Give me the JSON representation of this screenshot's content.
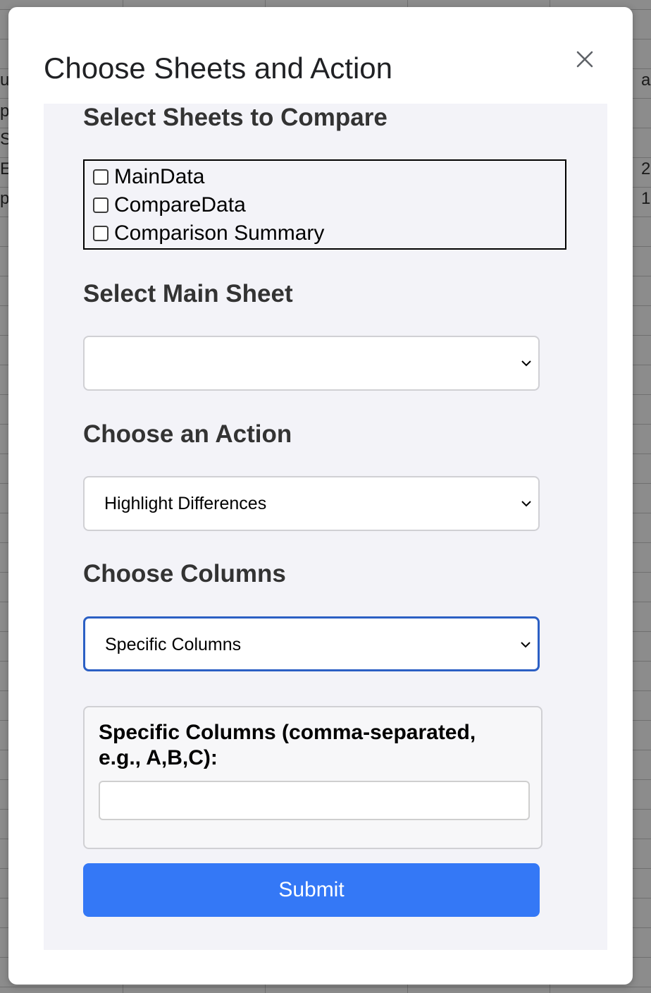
{
  "background": {
    "left_fragments": [
      "u",
      "p",
      "S",
      "E",
      "p"
    ],
    "right_fragments": [
      "a",
      "2",
      "1"
    ]
  },
  "dialog": {
    "title": "Choose Sheets and Action",
    "close_icon": "close-icon"
  },
  "form": {
    "sheets_section_title": "Select Sheets to Compare",
    "sheets": [
      {
        "label": "MainData",
        "checked": false
      },
      {
        "label": "CompareData",
        "checked": false
      },
      {
        "label": "Comparison Summary",
        "checked": false
      }
    ],
    "main_sheet_title": "Select Main Sheet",
    "main_sheet_value": "",
    "action_title": "Choose an Action",
    "action_value": "Highlight Differences",
    "columns_title": "Choose Columns",
    "columns_value": "Specific Columns",
    "specific_columns_label": "Specific Columns (comma-separated, e.g., A,B,C):",
    "specific_columns_value": "",
    "submit_label": "Submit"
  },
  "colors": {
    "submit_button": "#3478f6",
    "focus_border": "#2b5fc4",
    "panel_background": "#f3f3f8"
  }
}
